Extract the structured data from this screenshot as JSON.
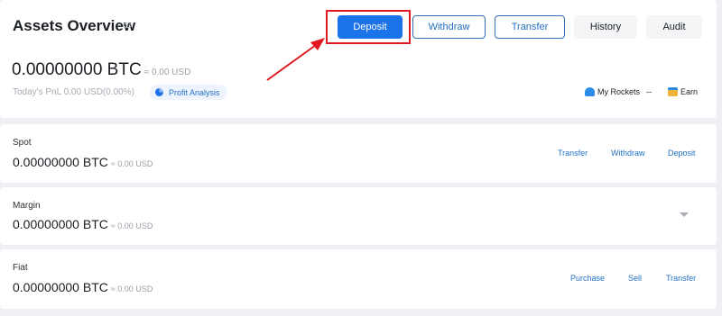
{
  "overview": {
    "title": "Assets Overview",
    "buttons": {
      "deposit": "Deposit",
      "withdraw": "Withdraw",
      "transfer": "Transfer",
      "history": "History",
      "audit": "Audit"
    },
    "balance": "0.00000000 BTC",
    "balance_fiat": "≈ 0.00 USD",
    "pnl": "Today's PnL  0.00 USD(0.00%)",
    "profit_analysis": "Profit Analysis",
    "my_rockets_label": "My Rockets",
    "my_rockets_value": "--",
    "earn_label": "Earn"
  },
  "accounts": [
    {
      "name": "Spot",
      "balance": "0.00000000 BTC",
      "balance_fiat": "≈ 0.00 USD",
      "actions": [
        "Transfer",
        "Withdraw",
        "Deposit"
      ]
    },
    {
      "name": "Margin",
      "balance": "0.00000000 BTC",
      "balance_fiat": "≈ 0.00 USD",
      "actions": []
    },
    {
      "name": "Fiat",
      "balance": "0.00000000 BTC",
      "balance_fiat": "≈ 0.00 USD",
      "actions": [
        "Purchase",
        "Sell",
        "Transfer"
      ]
    }
  ],
  "colors": {
    "primary": "#1a73e8",
    "link": "#2370c2",
    "highlight": "#e0181f",
    "background": "#eef0f3"
  },
  "icons": [
    "eye-icon",
    "pie-chart-icon",
    "rocket-icon",
    "earn-icon",
    "chevron-down-icon",
    "annotation-arrow"
  ]
}
